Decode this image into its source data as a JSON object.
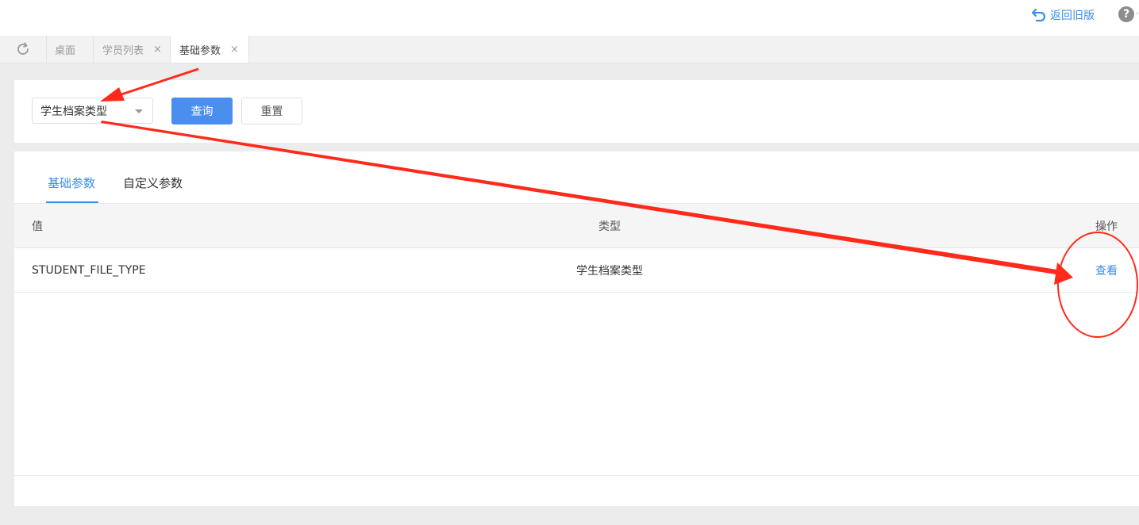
{
  "topbar": {
    "back_label": "返回旧版",
    "help_extra": "·"
  },
  "tabstrip": {
    "tabs": [
      {
        "label": "桌面",
        "closable": false
      },
      {
        "label": "学员列表",
        "closable": true
      },
      {
        "label": "基础参数",
        "closable": true,
        "active": true
      }
    ],
    "close_glyph": "×"
  },
  "filter": {
    "select_value": "学生档案类型",
    "query_label": "查询",
    "reset_label": "重置"
  },
  "panel": {
    "tabs": [
      "基础参数",
      "自定义参数"
    ],
    "active_tab": 0
  },
  "table": {
    "columns": [
      "值",
      "类型",
      "操作"
    ],
    "rows": [
      {
        "value": "STUDENT_FILE_TYPE",
        "type": "学生档案类型",
        "action": "查看"
      }
    ]
  },
  "colors": {
    "accent": "#3a8ee6",
    "primary_button": "#4a8ff0",
    "annotation": "#ff2a1a"
  }
}
